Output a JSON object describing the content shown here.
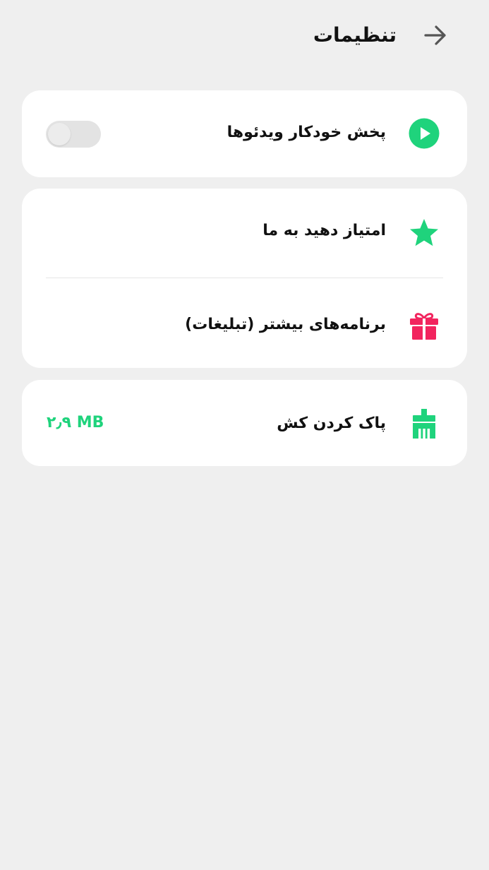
{
  "header": {
    "title": "تنظیمات",
    "back_icon": "arrow-right-icon"
  },
  "colors": {
    "background": "#efefef",
    "card": "#ffffff",
    "accent_green": "#1fd37c",
    "accent_pink": "#f2245e",
    "text": "#111111"
  },
  "settings": {
    "autoplay": {
      "label": "پخش خودکار ویدئوها",
      "icon": "play-circle-icon",
      "enabled": false
    },
    "rate": {
      "label": "امتیاز دهید به ما",
      "icon": "star-icon"
    },
    "more_apps": {
      "label": "برنامه‌های بیشتر (تبلیغات)",
      "icon": "gift-icon"
    },
    "clear_cache": {
      "label": "پاک کردن کش",
      "icon": "broom-icon",
      "size": "۲٫۹ MB"
    }
  }
}
